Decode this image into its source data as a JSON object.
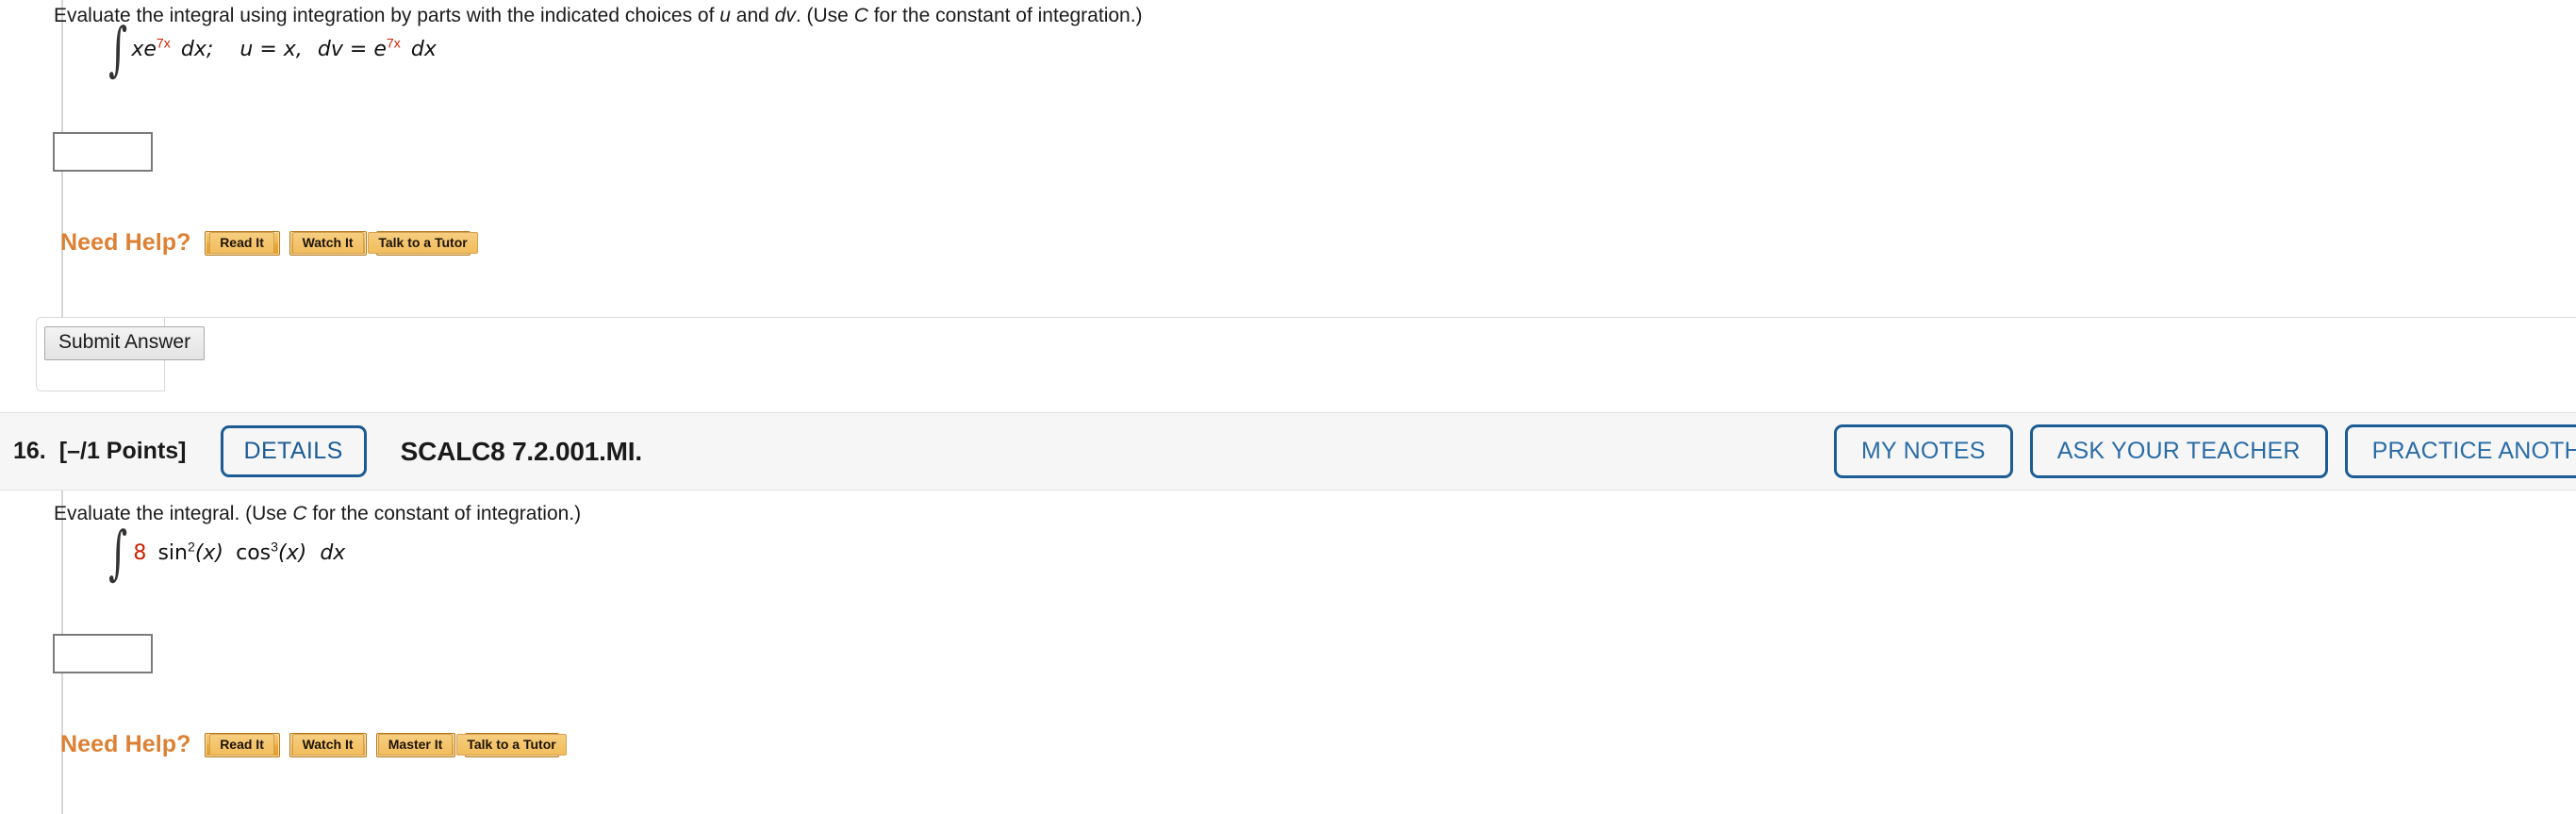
{
  "question15": {
    "prompt_parts": {
      "a": "Evaluate the integral using integration by parts with the indicated choices of ",
      "u": "u",
      "b": " and ",
      "dv": "dv",
      "c": ". (Use ",
      "C": "C",
      "d": " for the constant of integration.)"
    },
    "expression": {
      "integral_glyph": "∫",
      "base": "xe",
      "exponent": "7x",
      "differential": "dx;",
      "u_assign": "u = x,",
      "dv_assign": "dv = e",
      "dv_exponent": "7x",
      "dv_differential": "dx"
    },
    "answer_value": "",
    "need_help_label": "Need Help?",
    "help_buttons": [
      "Read It",
      "Watch It",
      "Talk to a Tutor"
    ],
    "submit_label": "Submit Answer"
  },
  "question16": {
    "header": {
      "number": "16.",
      "points": "[–/1 Points]",
      "details_label": "DETAILS",
      "code": "SCALC8 7.2.001.MI.",
      "actions": [
        "MY NOTES",
        "ASK YOUR TEACHER",
        "PRACTICE ANOTHER"
      ]
    },
    "prompt_parts": {
      "a": "Evaluate the integral. (Use ",
      "C": "C",
      "b": " for the constant of integration.)"
    },
    "expression": {
      "integral_glyph": "∫",
      "coefficient": "8",
      "sin": "sin",
      "sin_exponent": "2",
      "sin_arg": "(x)",
      "cos": "cos",
      "cos_exponent": "3",
      "cos_arg": "(x)",
      "differential": "dx"
    },
    "answer_value": "",
    "need_help_label": "Need Help?",
    "help_buttons": [
      "Read It",
      "Watch It",
      "Master It",
      "Talk to a Tutor"
    ]
  },
  "colors": {
    "accent_blue": "#1c5c94",
    "need_help_orange": "#dd8033",
    "math_red": "#cc2200",
    "header_band": "#f6f6f6",
    "input_border": "#7b7b7b"
  }
}
